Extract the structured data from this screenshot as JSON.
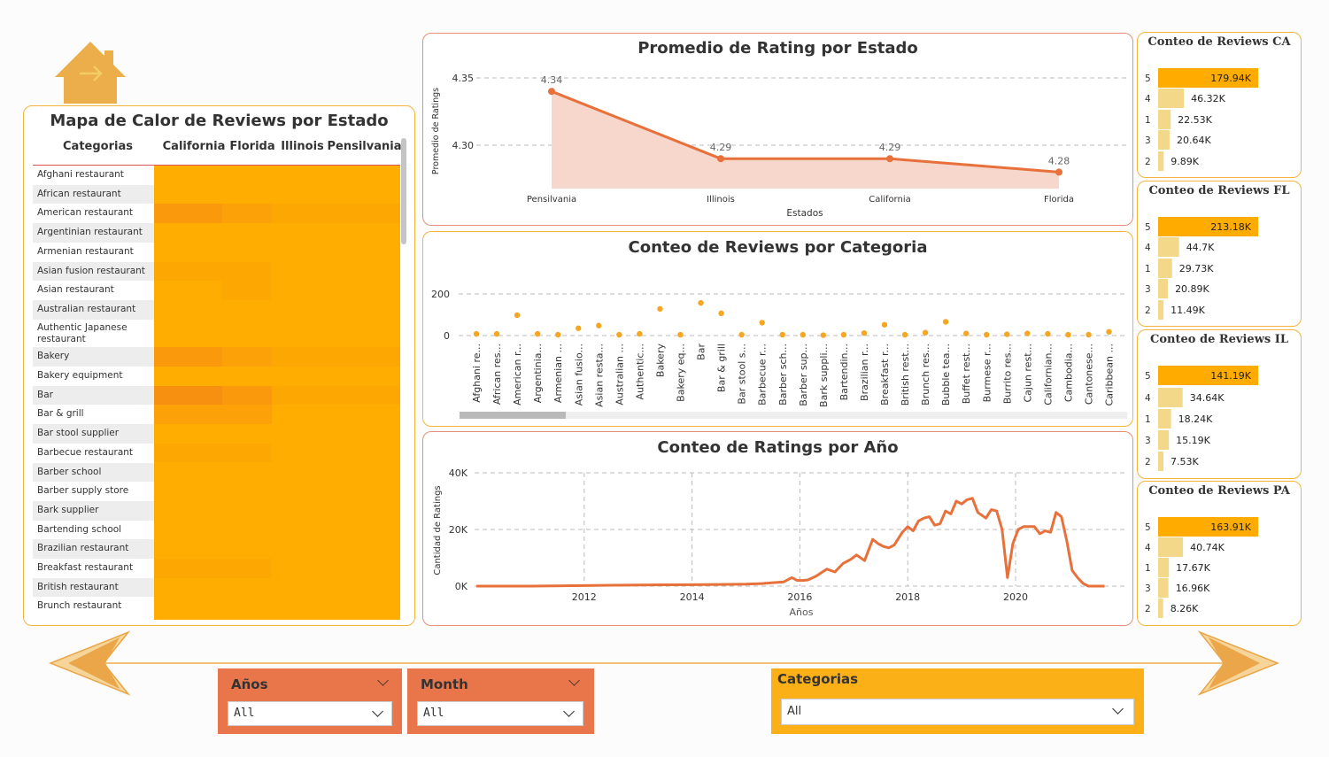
{
  "heatmap": {
    "title": "Mapa de Calor de Reviews por Estado",
    "columns": [
      "Categorias",
      "California",
      "Florida",
      "Illinois",
      "Pensilvania"
    ],
    "rows": [
      {
        "label": "Afghani restaurant",
        "values": [
          0,
          0,
          0,
          0
        ]
      },
      {
        "label": "African restaurant",
        "values": [
          0,
          0,
          0,
          0
        ]
      },
      {
        "label": "American restaurant",
        "values": [
          3,
          2,
          1,
          1
        ]
      },
      {
        "label": "Argentinian restaurant",
        "values": [
          0,
          0,
          0,
          0
        ]
      },
      {
        "label": "Armenian restaurant",
        "values": [
          0,
          0,
          0,
          0
        ]
      },
      {
        "label": "Asian fusion restaurant",
        "values": [
          1,
          1,
          0,
          0
        ]
      },
      {
        "label": "Asian restaurant",
        "values": [
          0,
          1,
          0,
          0
        ]
      },
      {
        "label": "Australian restaurant",
        "values": [
          0,
          0,
          0,
          0
        ]
      },
      {
        "label": "Authentic Japanese restaurant",
        "values": [
          0,
          0,
          0,
          0
        ]
      },
      {
        "label": "Bakery",
        "values": [
          3,
          2,
          1,
          1
        ]
      },
      {
        "label": "Bakery equipment",
        "values": [
          0,
          0,
          0,
          0
        ]
      },
      {
        "label": "Bar",
        "values": [
          4,
          3,
          1,
          1
        ]
      },
      {
        "label": "Bar & grill",
        "values": [
          2,
          2,
          0,
          0
        ]
      },
      {
        "label": "Bar stool supplier",
        "values": [
          0,
          0,
          0,
          0
        ]
      },
      {
        "label": "Barbecue restaurant",
        "values": [
          1,
          1,
          0,
          0
        ]
      },
      {
        "label": "Barber school",
        "values": [
          0,
          0,
          0,
          0
        ]
      },
      {
        "label": "Barber supply store",
        "values": [
          0,
          0,
          0,
          0
        ]
      },
      {
        "label": "Bark supplier",
        "values": [
          0,
          0,
          0,
          0
        ]
      },
      {
        "label": "Bartending school",
        "values": [
          0,
          0,
          0,
          0
        ]
      },
      {
        "label": "Brazilian restaurant",
        "values": [
          0,
          0,
          0,
          0
        ]
      },
      {
        "label": "Breakfast restaurant",
        "values": [
          1,
          1,
          0,
          0
        ]
      },
      {
        "label": "British restaurant",
        "values": [
          0,
          0,
          0,
          0
        ]
      },
      {
        "label": "Brunch restaurant",
        "values": [
          0,
          0,
          0,
          0
        ]
      }
    ]
  },
  "chart_data": [
    {
      "type": "area",
      "title": "Promedio de Rating por Estado",
      "xlabel": "Estados",
      "ylabel": "Promedio de Ratings",
      "categories": [
        "Pensilvania",
        "Illinois",
        "California",
        "Florida"
      ],
      "values": [
        4.34,
        4.29,
        4.29,
        4.28
      ],
      "data_labels": [
        "4.34",
        "4.29",
        "4.29",
        "4.28"
      ],
      "yticks": [
        "4.35",
        "4.30"
      ],
      "ylim": [
        4.27,
        4.35
      ],
      "color": "#e8703a",
      "fill": "#f7d6cb"
    },
    {
      "type": "scatter",
      "title": "Conteo de Reviews por Categoria",
      "xlabel": "",
      "ylabel": "",
      "categories": [
        "Afghani re...",
        "African res...",
        "American r...",
        "Argentinia...",
        "Armenian ...",
        "Asian fusio...",
        "Asian resta...",
        "Australian ...",
        "Authentic...",
        "Bakery",
        "Bakery eq...",
        "Bar",
        "Bar & grill",
        "Bar stool s...",
        "Barbecue r...",
        "Barber sch...",
        "Barber sup...",
        "Bark suppli...",
        "Bartendin...",
        "Brazilian r...",
        "Breakfast r...",
        "British rest...",
        "Brunch res...",
        "Bubble tea...",
        "Buffet rest...",
        "Burmese r...",
        "Burrito res...",
        "Cajun rest...",
        "Californian...",
        "Cambodia...",
        "Cantonese...",
        "Caribbean ..."
      ],
      "values": [
        8,
        8,
        98,
        8,
        4,
        35,
        48,
        4,
        8,
        128,
        4,
        157,
        107,
        4,
        62,
        4,
        4,
        2,
        4,
        12,
        52,
        4,
        14,
        66,
        10,
        4,
        6,
        10,
        8,
        4,
        4,
        18
      ],
      "yticks": [
        "200",
        "0"
      ],
      "ylim": [
        0,
        200
      ],
      "color": "#f5a623"
    },
    {
      "type": "line",
      "title": "Conteo de Ratings por Año",
      "xlabel": "Años",
      "ylabel": "Cantidad de Ratings",
      "xticks": [
        "2012",
        "2014",
        "2016",
        "2018",
        "2020"
      ],
      "yticks": [
        "40K",
        "20K",
        "0K"
      ],
      "xlim": [
        2010.0,
        2021.8
      ],
      "ylim": [
        0,
        40000
      ],
      "x": [
        2010.0,
        2011.0,
        2012.0,
        2012.5,
        2013.0,
        2013.5,
        2014.0,
        2014.5,
        2015.0,
        2015.3,
        2015.5,
        2015.7,
        2015.85,
        2015.95,
        2016.05,
        2016.15,
        2016.3,
        2016.5,
        2016.65,
        2016.8,
        2016.95,
        2017.05,
        2017.2,
        2017.35,
        2017.45,
        2017.55,
        2017.65,
        2017.75,
        2017.9,
        2018.0,
        2018.1,
        2018.2,
        2018.3,
        2018.4,
        2018.5,
        2018.6,
        2018.7,
        2018.8,
        2018.9,
        2019.0,
        2019.1,
        2019.2,
        2019.3,
        2019.45,
        2019.55,
        2019.65,
        2019.75,
        2019.85,
        2019.95,
        2020.05,
        2020.15,
        2020.25,
        2020.35,
        2020.45,
        2020.55,
        2020.65,
        2020.75,
        2020.85,
        2020.95,
        2021.05,
        2021.15,
        2021.25,
        2021.35,
        2021.45,
        2021.55,
        2021.65
      ],
      "values": [
        0,
        0,
        200,
        300,
        400,
        450,
        500,
        600,
        700,
        900,
        1200,
        1500,
        3000,
        2000,
        2000,
        2200,
        3500,
        6000,
        5000,
        8000,
        9500,
        11000,
        9000,
        16500,
        15000,
        14000,
        13500,
        14500,
        19000,
        21000,
        19500,
        23000,
        24000,
        24500,
        21500,
        22000,
        26500,
        25500,
        30000,
        29000,
        30500,
        31000,
        26000,
        24000,
        27000,
        26500,
        20000,
        3000,
        15000,
        20000,
        21000,
        21000,
        21000,
        18500,
        19500,
        19000,
        26000,
        24500,
        16000,
        5500,
        3000,
        1000,
        0,
        0,
        0,
        0
      ],
      "color": "#e8703a"
    },
    {
      "type": "bar",
      "title": "Conteo de Reviews CA",
      "categories": [
        "5",
        "4",
        "1",
        "3",
        "2"
      ],
      "values": [
        179940,
        46320,
        22530,
        20640,
        9890
      ],
      "labels": [
        "179.94K",
        "46.32K",
        "22.53K",
        "20.64K",
        "9.89K"
      ]
    },
    {
      "type": "bar",
      "title": "Conteo de Reviews FL",
      "categories": [
        "5",
        "4",
        "1",
        "3",
        "2"
      ],
      "values": [
        213180,
        44700,
        29730,
        20890,
        11490
      ],
      "labels": [
        "213.18K",
        "44.7K",
        "29.73K",
        "20.89K",
        "11.49K"
      ]
    },
    {
      "type": "bar",
      "title": "Conteo de Reviews IL",
      "categories": [
        "5",
        "4",
        "1",
        "3",
        "2"
      ],
      "values": [
        141190,
        34640,
        18240,
        15190,
        7530
      ],
      "labels": [
        "141.19K",
        "34.64K",
        "18.24K",
        "15.19K",
        "7.53K"
      ]
    },
    {
      "type": "bar",
      "title": "Conteo de Reviews PA",
      "categories": [
        "5",
        "4",
        "1",
        "3",
        "2"
      ],
      "values": [
        163910,
        40740,
        17670,
        16960,
        8260
      ],
      "labels": [
        "163.91K",
        "40.74K",
        "17.67K",
        "16.96K",
        "8.26K"
      ]
    }
  ],
  "slicers": {
    "anos": {
      "title": "Años",
      "value": "All"
    },
    "month": {
      "title": "Month",
      "value": "All"
    },
    "categorias": {
      "title": "Categorias",
      "value": "All"
    }
  },
  "colors": {
    "accent_orange": "#e8764a",
    "accent_amber": "#fcb017",
    "heat_base": "#ffad00",
    "heat_dark": "#f58a1f",
    "bar_top": "#ffab00",
    "bar_low": "#f4d88a"
  }
}
